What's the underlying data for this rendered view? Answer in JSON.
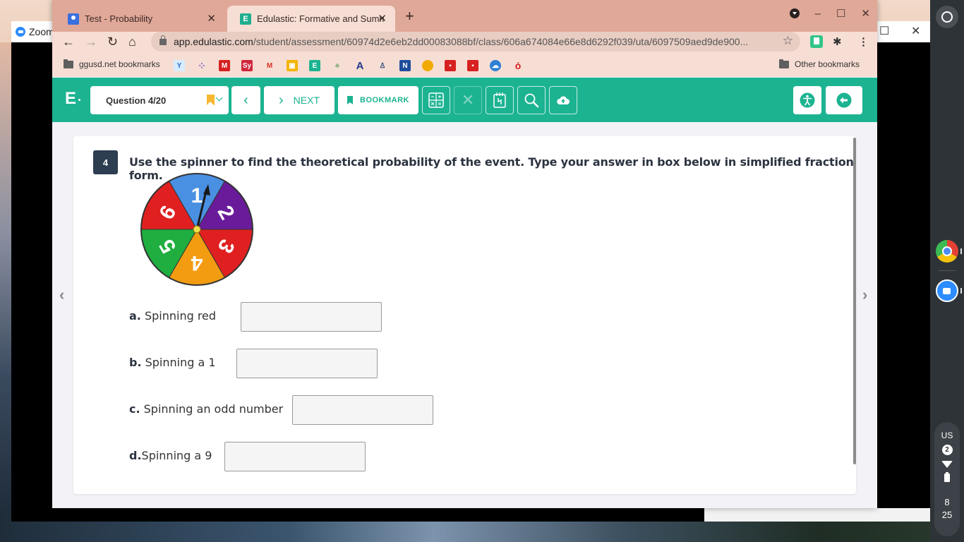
{
  "desktop": {
    "zoom_window_title": "Zoom"
  },
  "browser": {
    "tabs": [
      {
        "title": "Test - Probability",
        "favicon": "google-classroom-icon",
        "active": false
      },
      {
        "title": "Edulastic: Formative and Summ",
        "favicon": "edulastic-icon",
        "active": true
      }
    ],
    "url_host": "app.edulastic.com",
    "url_path": "/student/assessment/60974d2e6eb2dd00083088bf/class/606a674084e66e8d6292f039/uta/6097509aed9de900...",
    "bookmarks_bar": {
      "folder_label": "ggusd.net bookmarks",
      "other_bookmarks_label": "Other bookmarks",
      "icons": [
        "yd-icon",
        "dots-icon",
        "m-icon",
        "sy-icon",
        "gmail-icon",
        "classroom-icon",
        "edulastic-icon",
        "tree-icon",
        "a-icon",
        "figure-icon",
        "n-icon",
        "circle-icon",
        "red-app-icon",
        "red-app-icon-2",
        "cloud-icon",
        "apple-icon"
      ]
    }
  },
  "app": {
    "logo": "E",
    "question_selector": "Question 4/20",
    "next_label": "NEXT",
    "bookmark_label": "BOOKMARK",
    "colors": {
      "brand": "#1cb391",
      "bookmark_flag": "#f7b731",
      "question_badge": "#2c3e50"
    }
  },
  "question": {
    "number": "4",
    "prompt": "Use the spinner to find the theoretical probability of the event. Type your answer in box below in simplified fraction form.",
    "spinner": {
      "sections": [
        {
          "label": "1",
          "color": "#4a90e2"
        },
        {
          "label": "2",
          "color": "#6a1b9a"
        },
        {
          "label": "3",
          "color": "#e02020"
        },
        {
          "label": "4",
          "color": "#f39c12"
        },
        {
          "label": "5",
          "color": "#1fae3f"
        },
        {
          "label": "6",
          "color": "#e02020"
        }
      ]
    },
    "parts": [
      {
        "letter": "a.",
        "text": " Spinning red",
        "value": ""
      },
      {
        "letter": "b.",
        "text": " Spinning a 1",
        "value": ""
      },
      {
        "letter": "c.",
        "text": " Spinning an odd number",
        "value": ""
      },
      {
        "letter": "d.",
        "text": "Spinning a 9",
        "value": ""
      }
    ]
  },
  "system_tray": {
    "language": "US",
    "notification_count": "2",
    "clock_hour": "8",
    "clock_minute": "25"
  }
}
